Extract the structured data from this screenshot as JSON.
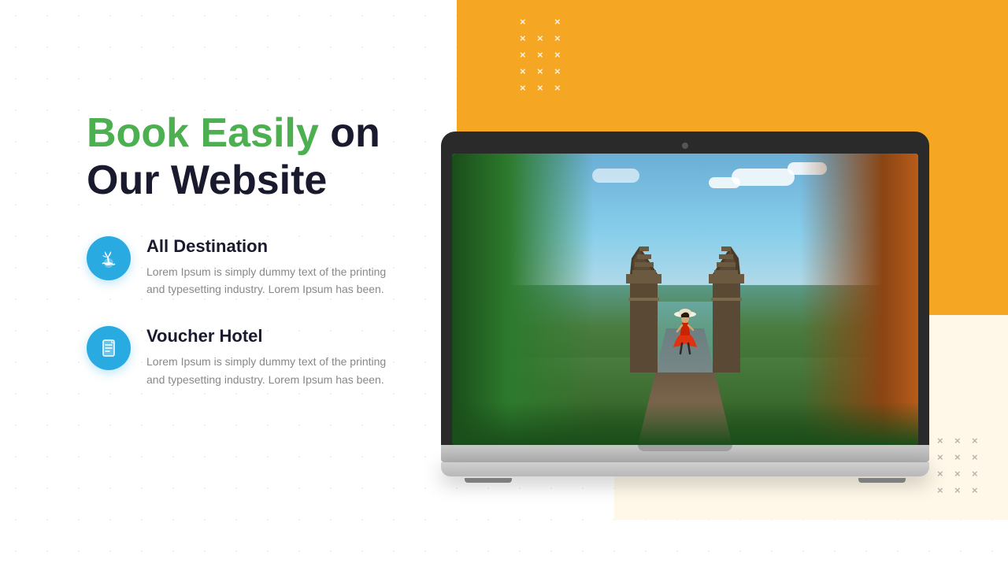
{
  "background": {
    "dot_color": "#cccccc",
    "shape_color": "#F5A623",
    "shape_light_color": "#FFF8E8"
  },
  "decorations": {
    "x_marks": [
      "×",
      "×",
      "×",
      "×",
      "×",
      "×",
      "×",
      "×",
      "×",
      "×",
      "×",
      "×"
    ]
  },
  "headline": {
    "part1": "Book Easily",
    "part2": " on",
    "part3": "Our Website",
    "part1_color": "#4CAF50",
    "part3_color": "#1a1a2e"
  },
  "features": [
    {
      "id": "destination",
      "icon": "island-icon",
      "title": "All Destination",
      "description": "Lorem Ipsum is simply dummy text of the printing and typesetting industry. Lorem Ipsum has been."
    },
    {
      "id": "voucher",
      "icon": "document-icon",
      "title": "Voucher Hotel",
      "description": "Lorem Ipsum is simply dummy text of the printing and typesetting industry. Lorem Ipsum has been."
    }
  ],
  "laptop": {
    "screen_content": "Travel destination - Bali gate landscape with woman in red dress"
  }
}
